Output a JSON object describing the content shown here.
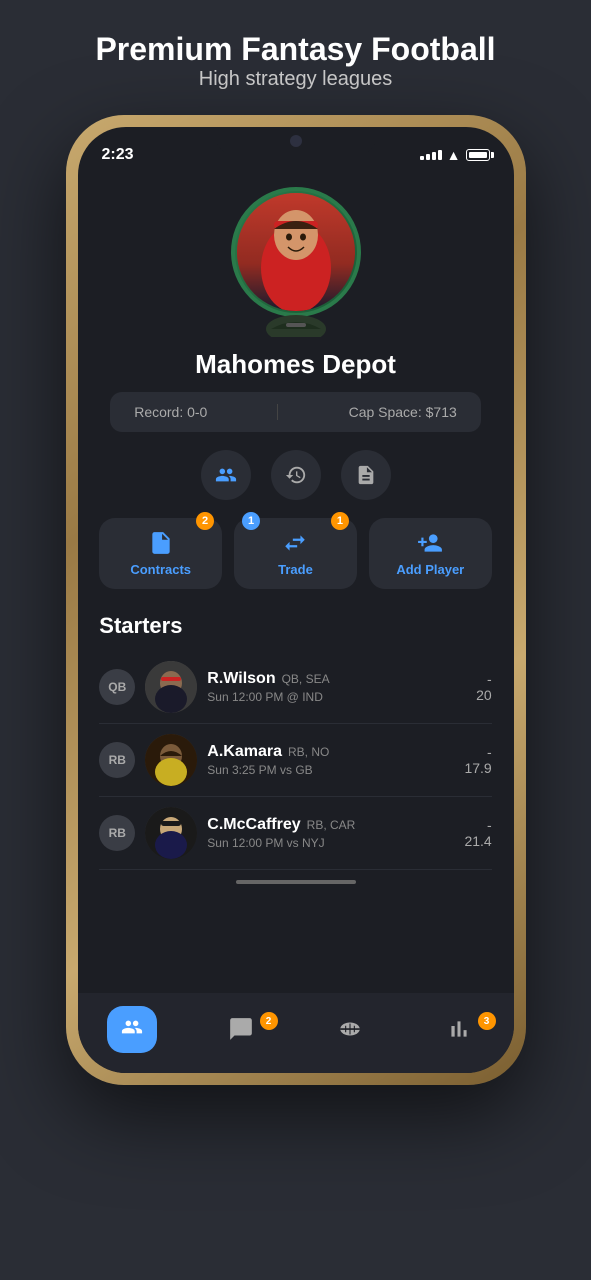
{
  "page": {
    "header_title": "Premium Fantasy Football",
    "header_subtitle": "High strategy leagues"
  },
  "status_bar": {
    "time": "2:23"
  },
  "team": {
    "name": "Mahomes Depot",
    "record_label": "Record: 0-0",
    "cap_space_label": "Cap Space: $713"
  },
  "action_icons": [
    {
      "id": "roster-icon",
      "label": "Roster"
    },
    {
      "id": "history-icon",
      "label": "History"
    },
    {
      "id": "notes-icon",
      "label": "Notes"
    }
  ],
  "action_buttons": [
    {
      "id": "contracts-btn",
      "label": "Contracts",
      "badge": "2",
      "badge_type": "orange"
    },
    {
      "id": "trade-btn",
      "label": "Trade",
      "badge_left": "1",
      "badge_right": "1",
      "badge_type": "mixed"
    },
    {
      "id": "add-player-btn",
      "label": "Add Player",
      "badge": null
    }
  ],
  "starters": {
    "title": "Starters",
    "players": [
      {
        "position": "QB",
        "name": "R.Wilson",
        "pos_team": "QB, SEA",
        "game": "Sun 12:00 PM @ IND",
        "score": "20"
      },
      {
        "position": "RB",
        "name": "A.Kamara",
        "pos_team": "RB, NO",
        "game": "Sun 3:25 PM vs GB",
        "score": "17.9"
      },
      {
        "position": "RB",
        "name": "C.McCaffrey",
        "pos_team": "RB, CAR",
        "game": "Sun 12:00 PM vs NYJ",
        "score": "21.4"
      }
    ]
  },
  "bottom_nav": [
    {
      "id": "nav-team",
      "label": "Team",
      "active": true,
      "badge": null
    },
    {
      "id": "nav-chat",
      "label": "Chat",
      "active": false,
      "badge": "2"
    },
    {
      "id": "nav-ball",
      "label": "Football",
      "active": false,
      "badge": null
    },
    {
      "id": "nav-stats",
      "label": "Stats",
      "active": false,
      "badge": "3"
    }
  ]
}
